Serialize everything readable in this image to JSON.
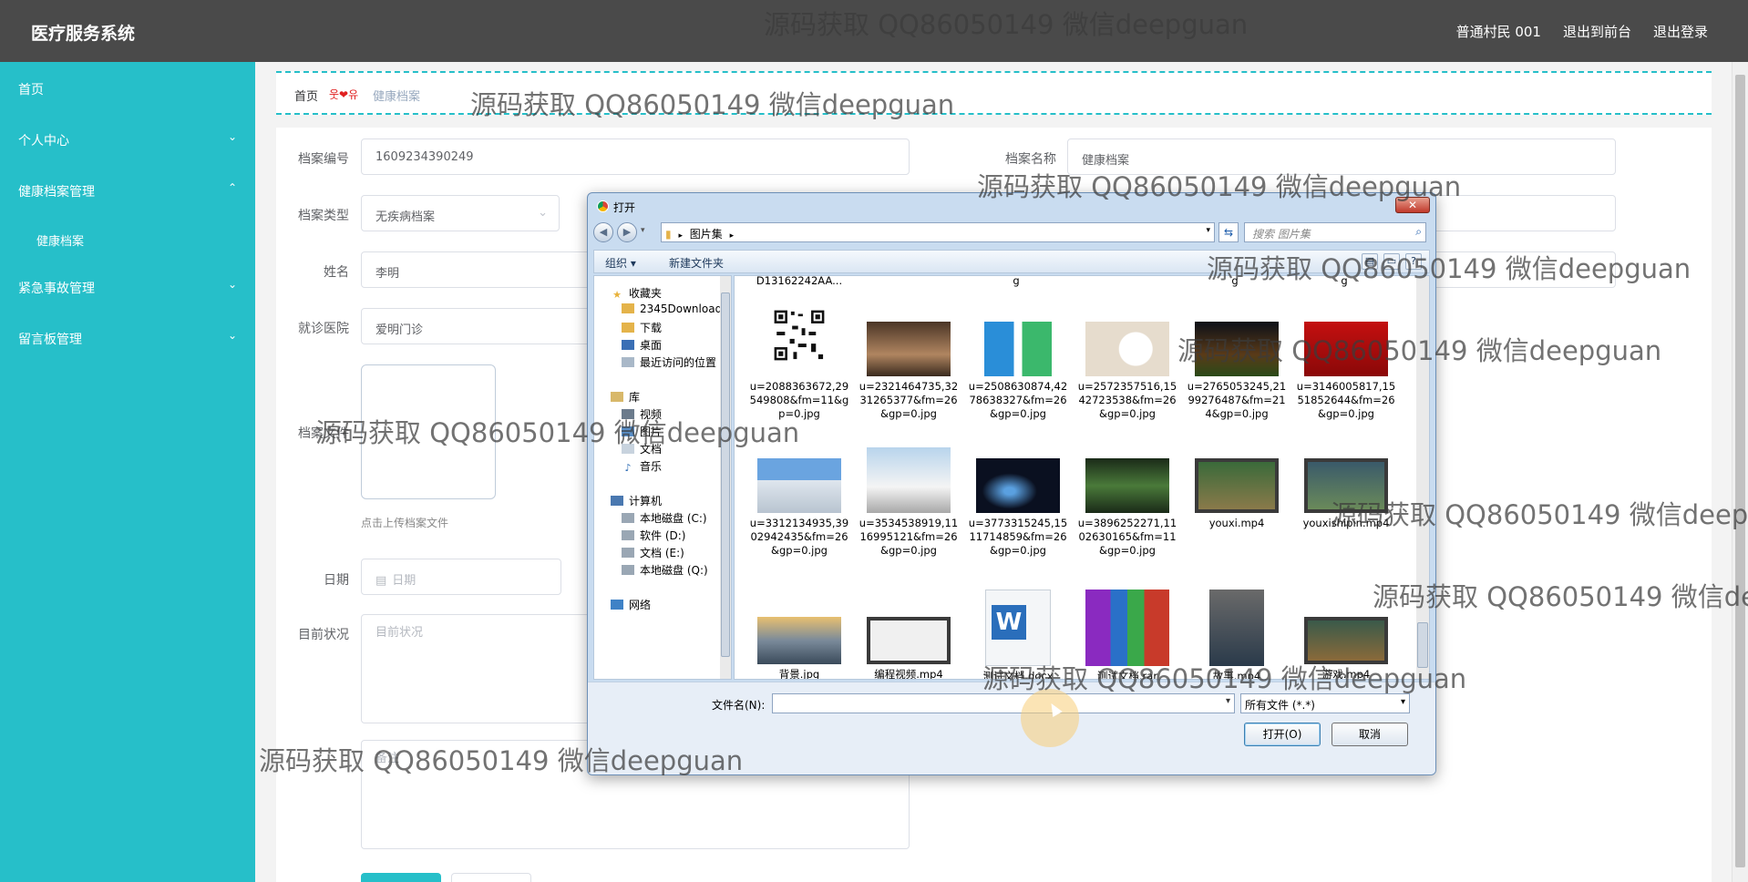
{
  "app": {
    "title": "医疗服务系统"
  },
  "header": {
    "user": "普通村民 001",
    "to_front": "退出到前台",
    "logout": "退出登录"
  },
  "sidebar": {
    "items": [
      {
        "label": "首页"
      },
      {
        "label": "个人中心"
      },
      {
        "label": "健康档案管理"
      },
      {
        "label": "健康档案"
      },
      {
        "label": "紧急事故管理"
      },
      {
        "label": "留言板管理"
      }
    ]
  },
  "breadcrumb": {
    "home": "首页",
    "sep": "웃❤유",
    "current": "健康档案"
  },
  "form": {
    "file_no_label": "档案编号",
    "file_no_value": "1609234390249",
    "file_name_label": "档案名称",
    "file_name_value": "健康档案",
    "type_label": "档案类型",
    "type_value": "无疾病档案",
    "name_label": "姓名",
    "name_value": "李明",
    "hospital_label": "就诊医院",
    "hospital_value": "爱明门诊",
    "file_label": "档案文件",
    "upload_tip": "点击上传档案文件",
    "date_label": "日期",
    "date_placeholder": "日期",
    "status_label": "目前状况",
    "status_placeholder": "目前状况",
    "remark_placeholder": "备注"
  },
  "dialog": {
    "title": "打开",
    "path": "图片集",
    "search_placeholder": "搜索 图片集",
    "organize": "组织 ▾",
    "new_folder": "新建文件夹",
    "nav": [
      "收藏夹",
      "2345Downloads",
      "下载",
      "桌面",
      "最近访问的位置",
      "库",
      "视频",
      "图片",
      "文档",
      "音乐",
      "计算机",
      "本地磁盘 (C:)",
      "软件 (D:)",
      "文档 (E:)",
      "本地磁盘 (Q:)",
      "网络"
    ],
    "top_partial": [
      "D13162242AA...",
      "g",
      "g",
      "g"
    ],
    "files": [
      "u=2088363672,29549808&fm=11&gp=0.jpg",
      "u=2321464735,3231265377&fm=26&gp=0.jpg",
      "u=2508630874,4278638327&fm=26&gp=0.jpg",
      "u=2572357516,1542723538&fm=26&gp=0.jpg",
      "u=2765053245,2199276487&fm=214&gp=0.jpg",
      "u=3146005817,1551852644&fm=26&gp=0.jpg",
      "u=3312134935,3902942435&fm=26&gp=0.jpg",
      "u=3534538919,1116995121&fm=26&gp=0.jpg",
      "u=3773315245,1511714859&fm=26&gp=0.jpg",
      "u=3896252271,1102630165&fm=11&gp=0.jpg",
      "youxi.mp4",
      "youxishipin.mp4",
      "背景.jpg",
      "编程视频.mp4",
      "测试文档.docx",
      "测试文档.rar",
      "故事.mp4",
      "游戏.mp4"
    ],
    "filename_label": "文件名(N):",
    "filetype": "所有文件 (*.*)",
    "open_btn": "打开(O)",
    "cancel_btn": "取消"
  },
  "watermark": "源码获取 QQ86050149 微信deepguan",
  "colors": {
    "sidebar": "#26bfc9",
    "topbar": "#4a4a4a",
    "accent": "#26bfc9"
  }
}
